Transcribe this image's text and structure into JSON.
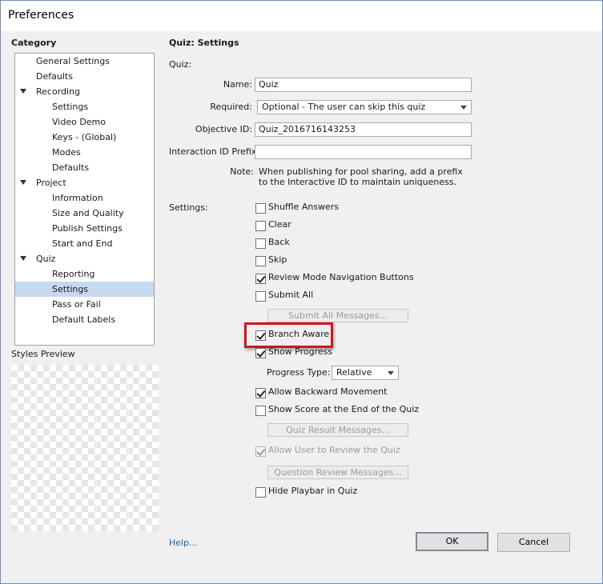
{
  "window": {
    "title": "Preferences"
  },
  "category": {
    "heading": "Category",
    "items": [
      {
        "label": "General Settings",
        "level": 0,
        "expandable": false,
        "selected": false
      },
      {
        "label": "Defaults",
        "level": 0,
        "expandable": false,
        "selected": false
      },
      {
        "label": "Recording",
        "level": 0,
        "expandable": true,
        "selected": false
      },
      {
        "label": "Settings",
        "level": 1,
        "expandable": false,
        "selected": false
      },
      {
        "label": "Video Demo",
        "level": 1,
        "expandable": false,
        "selected": false
      },
      {
        "label": "Keys - (Global)",
        "level": 1,
        "expandable": false,
        "selected": false
      },
      {
        "label": "Modes",
        "level": 1,
        "expandable": false,
        "selected": false
      },
      {
        "label": "Defaults",
        "level": 1,
        "expandable": false,
        "selected": false
      },
      {
        "label": "Project",
        "level": 0,
        "expandable": true,
        "selected": false
      },
      {
        "label": "Information",
        "level": 1,
        "expandable": false,
        "selected": false
      },
      {
        "label": "Size and Quality",
        "level": 1,
        "expandable": false,
        "selected": false
      },
      {
        "label": "Publish Settings",
        "level": 1,
        "expandable": false,
        "selected": false
      },
      {
        "label": "Start and End",
        "level": 1,
        "expandable": false,
        "selected": false
      },
      {
        "label": "Quiz",
        "level": 0,
        "expandable": true,
        "selected": false
      },
      {
        "label": "Reporting",
        "level": 1,
        "expandable": false,
        "selected": false
      },
      {
        "label": "Settings",
        "level": 1,
        "expandable": false,
        "selected": true
      },
      {
        "label": "Pass or Fail",
        "level": 1,
        "expandable": false,
        "selected": false
      },
      {
        "label": "Default Labels",
        "level": 1,
        "expandable": false,
        "selected": false
      }
    ]
  },
  "styles_preview": {
    "label": "Styles Preview"
  },
  "panel": {
    "title": "Quiz: Settings",
    "quiz_section": "Quiz:",
    "name": {
      "label": "Name:",
      "value": "Quiz"
    },
    "required": {
      "label": "Required:",
      "value": "Optional - The user can skip this quiz"
    },
    "objective_id": {
      "label": "Objective ID:",
      "value": "Quiz_2016716143253"
    },
    "interaction_prefix": {
      "label": "Interaction ID Prefix:",
      "value": ""
    },
    "note": {
      "label": "Note:",
      "line1": "When publishing for pool sharing, add a prefix",
      "line2": "to the Interactive ID to maintain uniqueness."
    },
    "settings_label": "Settings:",
    "checkboxes": {
      "shuffle_answers": {
        "label": "Shuffle Answers",
        "checked": false,
        "enabled": true
      },
      "clear": {
        "label": "Clear",
        "checked": false,
        "enabled": true
      },
      "back": {
        "label": "Back",
        "checked": false,
        "enabled": true
      },
      "skip": {
        "label": "Skip",
        "checked": false,
        "enabled": true
      },
      "review_mode_nav": {
        "label": "Review Mode Navigation Buttons",
        "checked": true,
        "enabled": true
      },
      "submit_all": {
        "label": "Submit All",
        "checked": false,
        "enabled": true
      },
      "branch_aware": {
        "label": "Branch Aware",
        "checked": true,
        "enabled": true
      },
      "show_progress": {
        "label": "Show Progress",
        "checked": true,
        "enabled": true
      },
      "allow_backward": {
        "label": "Allow Backward Movement",
        "checked": true,
        "enabled": true
      },
      "show_score": {
        "label": "Show Score at the End of the Quiz",
        "checked": false,
        "enabled": true
      },
      "allow_review": {
        "label": "Allow User to Review the Quiz",
        "checked": true,
        "enabled": false
      },
      "hide_playbar": {
        "label": "Hide Playbar in Quiz",
        "checked": false,
        "enabled": true
      }
    },
    "buttons": {
      "submit_all_messages": "Submit All Messages...",
      "quiz_result_messages": "Quiz Result Messages...",
      "question_review_messages": "Question Review Messages..."
    },
    "progress_type": {
      "label": "Progress Type:",
      "value": "Relative"
    }
  },
  "footer": {
    "help": "Help...",
    "ok": "OK",
    "cancel": "Cancel"
  },
  "colors": {
    "highlight": "#d2141c",
    "selected_row": "#c7d9f1",
    "link": "#1560b2"
  }
}
